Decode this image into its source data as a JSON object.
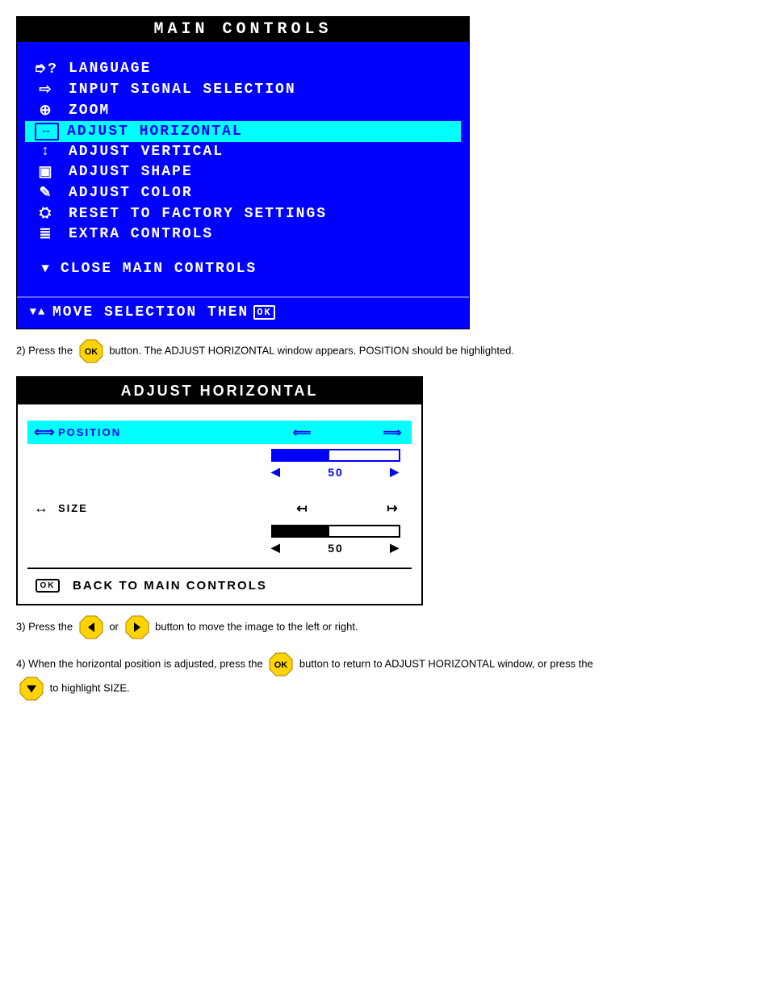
{
  "main_controls": {
    "title": "MAIN CONTROLS",
    "items": [
      {
        "icon": "speech-question",
        "icon_glyph": "➮?",
        "label": "LANGUAGE"
      },
      {
        "icon": "arrow-in",
        "icon_glyph": "⇨",
        "label": "INPUT SIGNAL SELECTION"
      },
      {
        "icon": "magnifier-plus",
        "icon_glyph": "⊕",
        "label": "ZOOM"
      },
      {
        "icon": "arrows-h",
        "icon_glyph": "↔",
        "label": "ADJUST HORIZONTAL",
        "selected": true
      },
      {
        "icon": "arrows-v",
        "icon_glyph": "↕",
        "label": "ADJUST VERTICAL"
      },
      {
        "icon": "shape",
        "icon_glyph": "▣",
        "label": "ADJUST SHAPE"
      },
      {
        "icon": "palette",
        "icon_glyph": "✎",
        "label": "ADJUST COLOR"
      },
      {
        "icon": "factory",
        "icon_glyph": "⛭",
        "label": "RESET TO FACTORY SETTINGS"
      },
      {
        "icon": "list",
        "icon_glyph": "≣",
        "label": "EXTRA CONTROLS"
      }
    ],
    "close": {
      "icon_glyph": "▼",
      "label": "CLOSE MAIN CONTROLS"
    },
    "footer": {
      "icon_glyph": "▼▲",
      "label": "MOVE SELECTION THEN",
      "ok": "OK"
    }
  },
  "step2": {
    "prefix": "2) Press the ",
    "suffix": " button. The ADJUST HORIZONTAL window appears. POSITION should be highlighted.",
    "button": "ok"
  },
  "adjust_horizontal": {
    "title": "ADJUST HORIZONTAL",
    "rows": [
      {
        "icon_glyph": "⟺",
        "label": "POSITION",
        "selected": true,
        "left_glyph": "⟸",
        "right_glyph": "⟹",
        "value": 50,
        "fill_pct": 45,
        "theme": "blue"
      },
      {
        "icon_glyph": "↔",
        "label": "SIZE",
        "selected": false,
        "left_glyph": "↤",
        "right_glyph": "↦",
        "value": 50,
        "fill_pct": 45,
        "theme": "black"
      }
    ],
    "back": {
      "ok": "OK",
      "label": "BACK TO MAIN CONTROLS"
    }
  },
  "step3": {
    "prefix": "3) Press the ",
    "mid": " or ",
    "suffix": " button to move the image to the left or right."
  },
  "step4": {
    "prefix": "4) When the horizontal position is adjusted, press the ",
    "mid": " button to return to ADJUST HORIZONTAL window, or press the ",
    "suffix": " to highlight SIZE."
  }
}
